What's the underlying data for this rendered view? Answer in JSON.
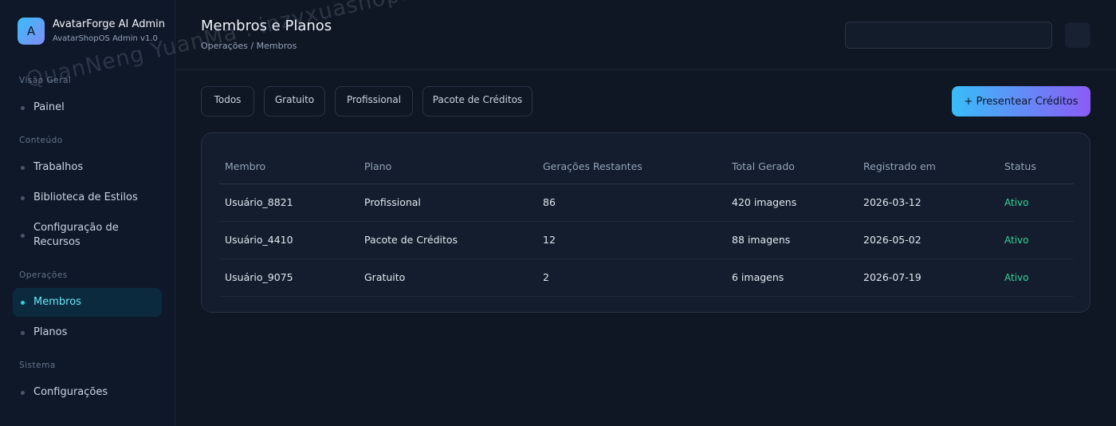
{
  "brand": {
    "logo_letter": "A",
    "title": "AvatarForge AI Admin",
    "subtitle": "AvatarShopOS Admin v1.0"
  },
  "sidebar": {
    "sections": [
      {
        "label": "Visão Geral",
        "items": [
          {
            "label": "Painel",
            "active": false
          }
        ]
      },
      {
        "label": "Conteúdo",
        "items": [
          {
            "label": "Trabalhos",
            "active": false
          },
          {
            "label": "Biblioteca de Estilos",
            "active": false
          },
          {
            "label": "Configuração de Recursos",
            "active": false
          }
        ]
      },
      {
        "label": "Operações",
        "items": [
          {
            "label": "Membros",
            "active": true
          },
          {
            "label": "Planos",
            "active": false
          }
        ]
      },
      {
        "label": "Sistema",
        "items": [
          {
            "label": "Configurações",
            "active": false
          }
        ]
      }
    ]
  },
  "header": {
    "title": "Membros e Planos",
    "breadcrumb": "Operações / Membros",
    "search_value": ""
  },
  "filters": [
    {
      "label": "Todos"
    },
    {
      "label": "Gratuito"
    },
    {
      "label": "Profissional"
    },
    {
      "label": "Pacote de Créditos"
    }
  ],
  "actions": {
    "gift_credits_label": "+ Presentear Créditos"
  },
  "table": {
    "columns": [
      "Membro",
      "Plano",
      "Gerações Restantes",
      "Total Gerado",
      "Registrado em",
      "Status"
    ],
    "rows": [
      [
        "Usuário_8821",
        "Profissional",
        "86",
        "420 imagens",
        "2026-03-12",
        "Ativo"
      ],
      [
        "Usuário_4410",
        "Pacote de Créditos",
        "12",
        "88 imagens",
        "2026-05-02",
        "Ativo"
      ],
      [
        "Usuário_9075",
        "Gratuito",
        "2",
        "6 imagens",
        "2026-07-19",
        "Ativo"
      ]
    ]
  },
  "watermark": "QuanNeng YuanMa : inzyxuashop.com",
  "colors": {
    "background": "#0f1624",
    "accent": "#22d3ee",
    "status_active": "#34d399",
    "gradient_start": "#38bdf8",
    "gradient_end": "#8b5cf6"
  }
}
